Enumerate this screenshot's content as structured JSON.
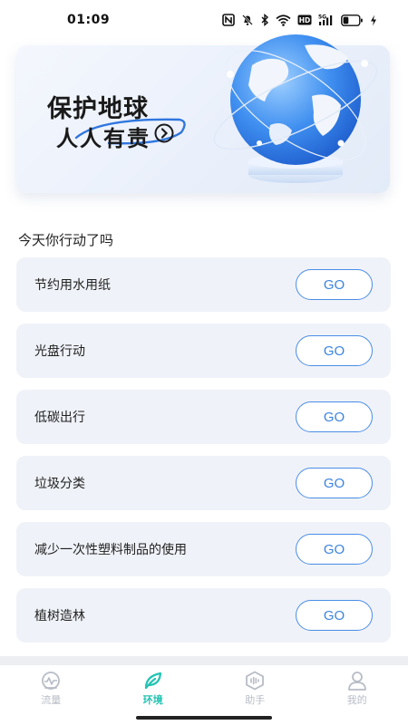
{
  "status_bar": {
    "time": "01:09",
    "icons": [
      "nfc-icon",
      "mute-bell-icon",
      "bluetooth-icon",
      "wifi-icon",
      "hd-icon",
      "5g-signal-icon",
      "battery-icon",
      "charging-bolt-icon"
    ],
    "network_label": "5G",
    "hd_label": "HD",
    "battery_level": 0.35
  },
  "banner": {
    "line1": "保护地球",
    "line2": "人人有责",
    "arrow_icon": "chevron-right-circle-icon",
    "illustration": "globe-illustration"
  },
  "section": {
    "title": "今天你行动了吗"
  },
  "tasks": [
    {
      "label": "节约用水用纸",
      "button": "GO"
    },
    {
      "label": "光盘行动",
      "button": "GO"
    },
    {
      "label": "低碳出行",
      "button": "GO"
    },
    {
      "label": "垃圾分类",
      "button": "GO"
    },
    {
      "label": "减少一次性塑料制品的使用",
      "button": "GO"
    },
    {
      "label": "植树造林",
      "button": "GO"
    }
  ],
  "tabs": [
    {
      "label": "流量",
      "icon": "traffic-gauge-icon",
      "active": false
    },
    {
      "label": "环境",
      "icon": "leaf-icon",
      "active": true
    },
    {
      "label": "助手",
      "icon": "assistant-hexagon-icon",
      "active": false
    },
    {
      "label": "我的",
      "icon": "user-icon",
      "active": false
    }
  ],
  "colors": {
    "accent_blue": "#3c84e0",
    "active_tab": "#22c3b2",
    "card_bg": "#eff2f8",
    "inactive_tab": "#b7bcc6"
  }
}
